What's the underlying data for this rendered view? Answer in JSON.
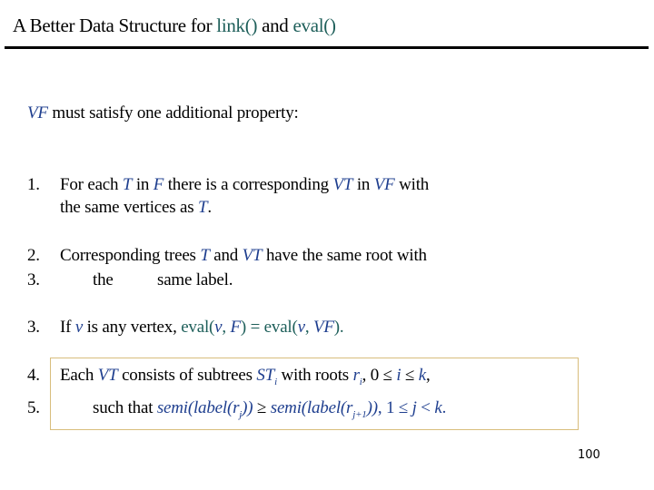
{
  "title": {
    "prefix": "A Better Data Structure for ",
    "link": "link()",
    "middle": " and ",
    "eval": "eval()"
  },
  "intro": {
    "vf": "VF",
    "text": " must satisfy one additional property:"
  },
  "items": {
    "item1": {
      "number": "1.",
      "line1": {
        "a": "For each ",
        "T": "T",
        "b": " in ",
        "F": "F",
        "c": " there is a corresponding ",
        "VT": "VT",
        "d": " in ",
        "VF": "VF",
        "e": " with"
      },
      "line2": {
        "a": "the same vertices as ",
        "T": "T",
        "b": "."
      }
    },
    "item2": {
      "number": "2.",
      "number2": "3.",
      "line1": {
        "a": "Corresponding trees ",
        "T": "T",
        "b": " and ",
        "VT": "VT",
        "c": " have the same root with"
      },
      "line2": {
        "a": "the",
        "b": "same label."
      }
    },
    "item3": {
      "number": "3.",
      "a": "If ",
      "v": "v",
      "b": " is any vertex, ",
      "eval1": "eval(",
      "v1": "v",
      "comma1": ", ",
      "F": "F",
      "eq": ") = eval(",
      "v2": "v",
      "comma2": ", ",
      "VF": "VF",
      "end": ")."
    },
    "item4": {
      "number": "4.",
      "number2": "5.",
      "line1": {
        "a": "Each ",
        "VT": "VT",
        "b": " consists of subtrees ",
        "ST": "ST",
        "ST_sub": "i",
        "c": " with roots ",
        "r": "r",
        "r_sub": "i",
        "d": ",  0 ≤ ",
        "i": "i",
        "e": " ≤ ",
        "k": "k",
        "f": ","
      },
      "line2": {
        "a": "such that ",
        "semi1": "semi(label(r",
        "sub1": "j",
        "close1": "))",
        "ge": " ≥ ",
        "semi2": "semi(label(r",
        "sub2": "j+1",
        "close2": "))",
        "b": ",  1 ≤ ",
        "j": "j",
        "c": " < ",
        "k": "k",
        "d": "."
      }
    }
  },
  "page_number": "100",
  "colors": {
    "teal": "#1e5f5a",
    "blue": "#1f3f8f",
    "box_border": "#d8bd7c"
  }
}
